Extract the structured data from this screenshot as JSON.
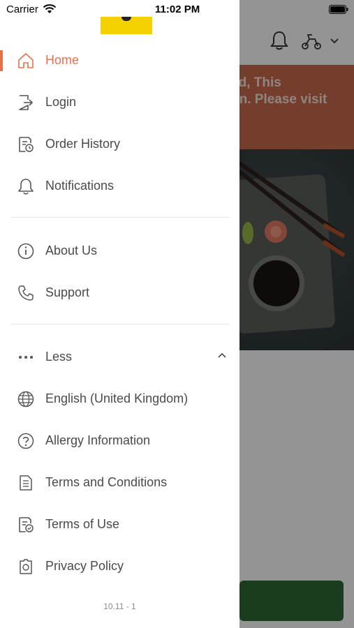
{
  "status_bar": {
    "carrier": "Carrier",
    "time": "11:02 PM"
  },
  "background": {
    "banner_text_line1": "ed, This",
    "banner_text_line2": "on. Please visit",
    "banner_color": "#c86a4c",
    "cta_color": "#2d6a35"
  },
  "drawer": {
    "accent_color": "#e5704d",
    "logo_color": "#f5d000",
    "items_primary": [
      {
        "label": "Home",
        "icon": "home-icon",
        "active": true
      },
      {
        "label": "Login",
        "icon": "login-icon"
      },
      {
        "label": "Order History",
        "icon": "order-history-icon"
      },
      {
        "label": "Notifications",
        "icon": "bell-icon"
      }
    ],
    "items_secondary": [
      {
        "label": "About Us",
        "icon": "info-icon"
      },
      {
        "label": "Support",
        "icon": "phone-icon"
      }
    ],
    "more_toggle": {
      "label": "Less",
      "icon": "more-dots-icon",
      "chevron": "chevron-up-icon"
    },
    "items_more": [
      {
        "label": "English (United Kingdom)",
        "icon": "globe-icon"
      },
      {
        "label": "Allergy Information",
        "icon": "question-icon"
      },
      {
        "label": "Terms and Conditions",
        "icon": "document-icon"
      },
      {
        "label": "Terms of Use",
        "icon": "document-check-icon"
      },
      {
        "label": "Privacy Policy",
        "icon": "privacy-icon"
      }
    ],
    "version": "10.11 - 1"
  }
}
